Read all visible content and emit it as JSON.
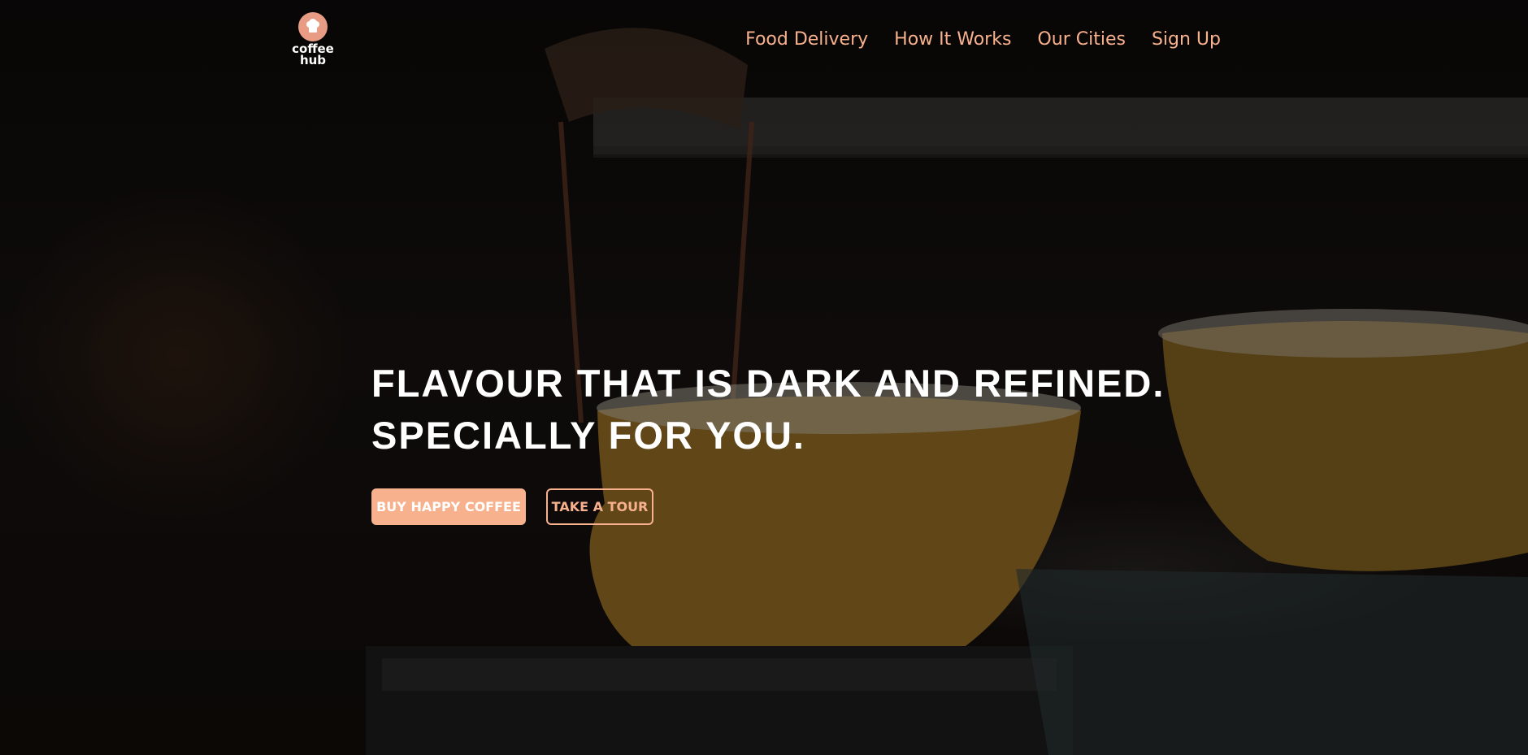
{
  "brand": {
    "logo_text": "coffee hub",
    "logo_icon": "chef-hat-icon"
  },
  "nav": {
    "items": [
      {
        "label": "Food Delivery"
      },
      {
        "label": "How It Works"
      },
      {
        "label": "Our Cities"
      },
      {
        "label": "Sign Up"
      }
    ]
  },
  "hero": {
    "headline_line1": "FLAVOUR THAT IS DARK AND REFINED.",
    "headline_line2": "SPECIALLY FOR YOU.",
    "primary_cta": "BUY HAPPY COFFEE",
    "secondary_cta": "TAKE A TOUR",
    "background": "espresso-machine-with-yellow-cups-photo"
  },
  "colors": {
    "accent": "#f7b18d",
    "logo": "#e79c83",
    "heading": "#ffffff"
  }
}
